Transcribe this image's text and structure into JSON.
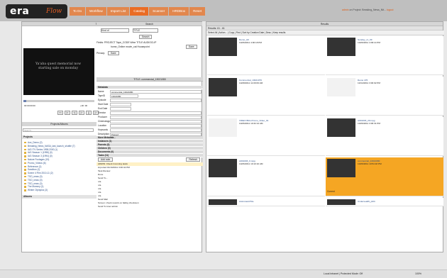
{
  "brand": {
    "logo_main": "era",
    "logo_sub": "Flow"
  },
  "nav": {
    "tabs": [
      {
        "label": "To Do"
      },
      {
        "label": "Workflow"
      },
      {
        "label": "Import List"
      },
      {
        "label": "Catalog"
      },
      {
        "label": "Scanner"
      },
      {
        "label": "HRDBox"
      },
      {
        "label": "Reset"
      }
    ]
  },
  "top_status": {
    "link_user": "admin",
    "text": "on Project: Breaking_News_Nit...",
    "logout": "logout"
  },
  "left_panel": {
    "title": "TITLE: commercial_13021080",
    "video_caption": "Ya'aba quest memorial now starting sale on monday",
    "timecode": "00:00:00:00",
    "speed": "+00 :00",
    "media_buttons": [
      "<<",
      "|<",
      "<|",
      "|>",
      "||",
      "|>"
    ],
    "projects_title": "Projects/Albums",
    "search_placeholder": "Search...",
    "projects_label": "Projects",
    "albums_label": "Albums",
    "projects": [
      "Ace_Demo (2)",
      "Breaking_News_NASA_last_launch_shuttle (7)",
      "IAG ITV Series 1998-2000 (1)",
      "IAG Season 1 (1998) (0)",
      "IAG Season 3 (1994) (0)",
      "Nature Footages (19)",
      "Promo_Videos (6)",
      "Reference (1)",
      "Sandbox (1)",
      "Scene 4 Film 2010-11 (2)",
      "TSO_news (0)",
      "TSO_news (0)",
      "TSO_news (0)",
      "The Mummy (1)",
      "Winter Olympics (3)"
    ]
  },
  "search": {
    "title": "Search",
    "field1": "Kind of",
    "field2": "TITLE",
    "button": "Search",
    "field_row": "Fields:  PROJECT  Tape_CODE  Wine  TITLE  AUDIOCLIP",
    "field_row2": "home_Online   movie_cat   Housepoint",
    "save_btn": "Save",
    "privacy_label": "Privacy:",
    "privacy_btn": "Save"
  },
  "metadata": {
    "panel_title": "TITLE: commercial_13021080",
    "section": "Metadata",
    "fields": [
      {
        "label": "Name",
        "value": "commercial_13021080"
      },
      {
        "label": "TapeID",
        "value": "13021080"
      },
      {
        "label": "Episode",
        "value": ""
      },
      {
        "label": "Start Date",
        "value": ""
      },
      {
        "label": "End Date",
        "value": ""
      },
      {
        "label": "Director",
        "value": ""
      },
      {
        "label": "Producer",
        "value": ""
      },
      {
        "label": "Cinematographer",
        "value": ""
      },
      {
        "label": "Location",
        "value": ""
      },
      {
        "label": "Keywords",
        "value": ""
      },
      {
        "label": "Description",
        "value": "Passed"
      }
    ],
    "more": "More Metadata...",
    "sections": [
      "Instances (1)",
      "Parents (0)",
      "Children (0)",
      "Documents (0)",
      "Tasks (11)"
    ],
    "tasks_add": "Add note",
    "tasks_refresh": "Refresh",
    "task_lines": [
      "ADMIN: Check Incoming tasks",
      "imported 01/13/2011 3:00:42 PM",
      "Task Review",
      "Done",
      "Send To...",
      "n/a",
      "n/a",
      "n/a",
      "n/a",
      "n/a",
      "Send Mail",
      "Screen: check rework on failing checksum",
      "Send To User admin"
    ]
  },
  "results": {
    "title": "Results",
    "count": "Results: 61 - 61",
    "toolbar": "Select All | Action... | Copy | Find | Sort by Creation Date | Desc | Keep results",
    "cards": [
      {
        "title": "Demo_A0",
        "date": "10/26/2011 4:00:18 PM",
        "thumb": "dark",
        "status": ""
      },
      {
        "title": "Sunday_cc_09",
        "date": "10/26/2011 4:09:14 PM",
        "thumb": "dark",
        "status": ""
      },
      {
        "title": "Commercial_13021076",
        "date": "10/28/2011 11:09:06 AM",
        "thumb": "dark",
        "status": ""
      },
      {
        "title": "Demo 476",
        "date": "10/14/2011 3:00:02 PM",
        "thumb": "light",
        "status": ""
      },
      {
        "title": "VIDEO BDL-Promo_Video_01",
        "date": "10/26/2011 10:32:14 AM",
        "thumb": "light",
        "status": ""
      },
      {
        "title": "A001003_20.mpg",
        "date": "10/26/2011 3:06:31 PM",
        "thumb": "dark",
        "status": ""
      },
      {
        "title": "A001003_0.mpg",
        "date": "10/26/2011 10:10:10 AM",
        "thumb": "dark",
        "status": ""
      },
      {
        "title": "commercial_13021080",
        "date": "10/26/2011 10:54:18 PM",
        "thumb": "dark",
        "status": "Current"
      },
      {
        "title": "AstronautsTitle",
        "date": "",
        "thumb": "dark",
        "status": ""
      },
      {
        "title": "Undersea06_pt04",
        "date": "",
        "thumb": "dark",
        "status": ""
      }
    ]
  },
  "footer": {
    "zone": "Local intranet | Protected Mode: Off",
    "zoom": "100%"
  }
}
